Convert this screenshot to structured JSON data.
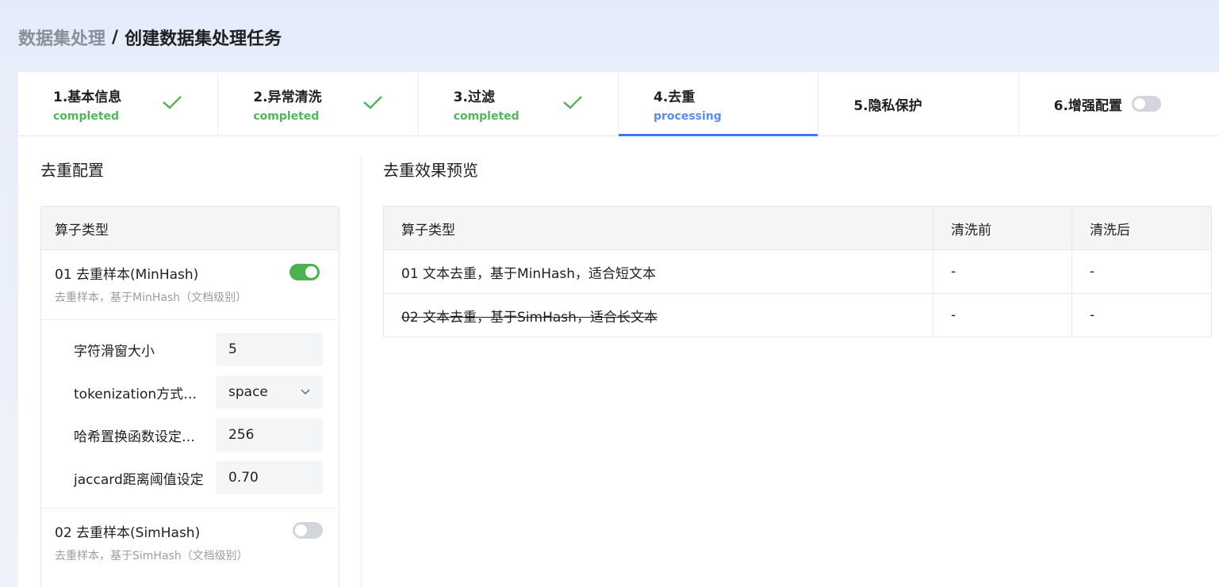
{
  "breadcrumb": {
    "parent": "数据集处理",
    "separator": "/",
    "current": "创建数据集处理任务"
  },
  "steps": [
    {
      "title": "1.基本信息",
      "status": "completed"
    },
    {
      "title": "2.异常清洗",
      "status": "completed"
    },
    {
      "title": "3.过滤",
      "status": "completed"
    },
    {
      "title": "4.去重",
      "status": "processing"
    },
    {
      "title": "5.隐私保护",
      "status": ""
    },
    {
      "title": "6.增强配置",
      "status": ""
    }
  ],
  "config": {
    "title": "去重配置",
    "header": "算子类型",
    "op1": {
      "name": "01 去重样本(MinHash)",
      "desc": "去重样本，基于MinHash（文档级别）",
      "enabled": true
    },
    "params": [
      {
        "label": "字符滑窗大小",
        "value": "5"
      },
      {
        "label": "tokenization方式设定",
        "value": "space"
      },
      {
        "label": "哈希置换函数设定数量",
        "value": "256"
      },
      {
        "label": "jaccard距离阈值设定",
        "value": "0.70"
      }
    ],
    "op2": {
      "name": "02 去重样本(SimHash)",
      "desc": "去重样本，基于SimHash（文档级别）",
      "enabled": false
    }
  },
  "preview": {
    "title": "去重效果预览",
    "columns": [
      "算子类型",
      "清洗前",
      "清洗后"
    ],
    "rows": [
      {
        "op": "01 文本去重，基于MinHash，适合短文本",
        "before": "-",
        "after": "-"
      },
      {
        "op": "02 文本去重，基于SimHash，适合长文本",
        "before": "-",
        "after": "-"
      }
    ]
  },
  "colors": {
    "accent": "#3c7be8",
    "success": "#52b75c",
    "toggle_on": "#4cb14f"
  }
}
